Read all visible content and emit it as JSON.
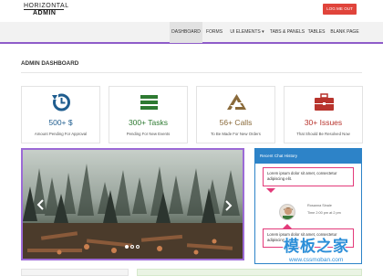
{
  "logo": {
    "line1": "HORIZONTAL",
    "line2": "ADMIN"
  },
  "header": {
    "logout_label": "LOG ME OUT"
  },
  "nav": [
    {
      "label": "DASHBOARD",
      "active": true
    },
    {
      "label": "FORMS",
      "active": false
    },
    {
      "label": "UI ELEMENTS ▾",
      "active": false
    },
    {
      "label": "TABS & PANELS",
      "active": false
    },
    {
      "label": "TABLES",
      "active": false
    },
    {
      "label": "BLANK PAGE",
      "active": false
    }
  ],
  "page_title": "ADMIN DASHBOARD",
  "cards": [
    {
      "icon": "history-icon",
      "value": "500+ $",
      "subtitle": "Amount Pending For Approval",
      "color": "#1f5d8f"
    },
    {
      "icon": "list-icon",
      "value": "300+ Tasks",
      "subtitle": "Pending For New Events",
      "color": "#2e7a32"
    },
    {
      "icon": "recycle-icon",
      "value": "56+ Calls",
      "subtitle": "To Be Made For New Orders",
      "color": "#8a6a3a"
    },
    {
      "icon": "briefcase-icon",
      "value": "30+ Issues",
      "subtitle": "That Should Be Resolved Now",
      "color": "#b8342d"
    }
  ],
  "slider": {
    "prev_icon": "chevron-left-icon",
    "next_icon": "chevron-right-icon",
    "dots": 3,
    "active_dot": 1
  },
  "chat": {
    "title": "Recent Chat History",
    "messages": [
      {
        "text": "Lorem ipsum dolor sit amet, consectetur adipiscing elit."
      },
      {
        "text": "Lorem ipsum dolor sit amet, consectetur adipiscing elit."
      }
    ],
    "author_name": "Rosanna Sinale",
    "author_time": "Time 2:00 pm at 2 pm"
  },
  "watermark": {
    "cn": "模板之家",
    "url": "www.cssmoban.com"
  },
  "colors": {
    "accent": "#8e5cc9",
    "logout": "#e0443b",
    "chat": "#2d83c8",
    "bubble_border": "#e33a7a"
  }
}
